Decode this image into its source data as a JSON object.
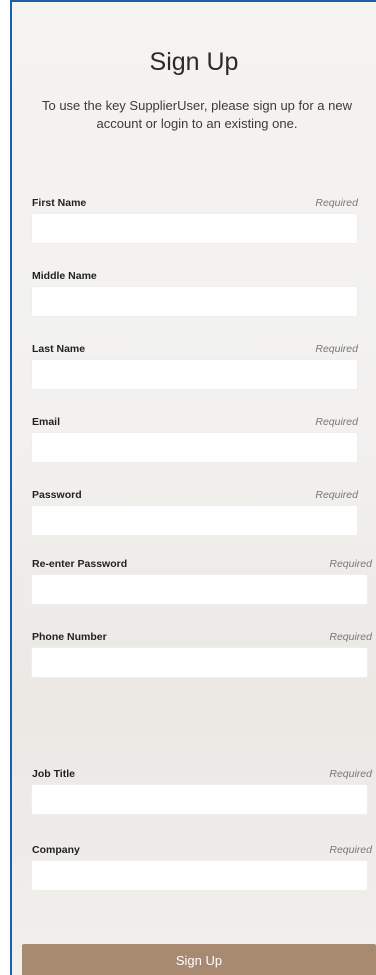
{
  "form": {
    "title": "Sign Up",
    "subtitle": "To use the key SupplierUser, please sign up for a new account or login to an existing one.",
    "required_text": "Required",
    "submit_label": "Sign Up",
    "fields": {
      "first_name": {
        "label": "First Name",
        "value": "",
        "required": true
      },
      "middle_name": {
        "label": "Middle Name",
        "value": "",
        "required": false
      },
      "last_name": {
        "label": "Last Name",
        "value": "",
        "required": true
      },
      "email": {
        "label": "Email",
        "value": "",
        "required": true
      },
      "password": {
        "label": "Password",
        "value": "",
        "required": true
      },
      "reenter_password": {
        "label": "Re-enter Password",
        "value": "",
        "required": true
      },
      "phone_number": {
        "label": "Phone Number",
        "value": "",
        "required": true
      },
      "job_title": {
        "label": "Job Title",
        "value": "",
        "required": true
      },
      "company": {
        "label": "Company",
        "value": "",
        "required": true
      }
    }
  },
  "colors": {
    "frame_border": "#1c5fa8",
    "button": "#a88a70"
  }
}
